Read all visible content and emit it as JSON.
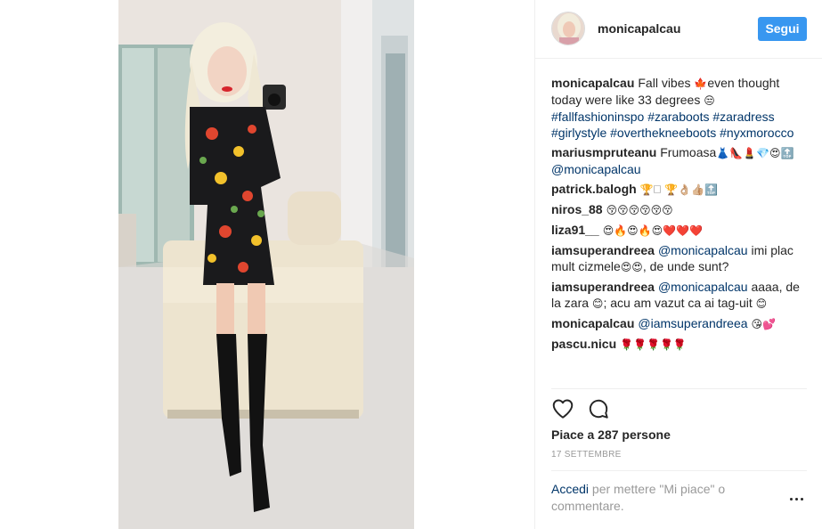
{
  "post": {
    "username": "monicapalcau",
    "follow_label": "Segui",
    "caption": {
      "user": "monicapalcau",
      "text1": "Fall vibes ",
      "text2": "even thought today were like 33 degrees ",
      "hashtags": [
        "#fallfashioninspo",
        "#zaraboots",
        "#zaradress",
        "#girlystyle",
        "#overthekneeboots",
        "#nyxmorocco"
      ]
    },
    "comments": [
      {
        "user": "mariusmpruteanu",
        "text": "Frumoasa",
        "emoji": "👗👠💄💎😍🔝",
        "mention": "@monicapalcau"
      },
      {
        "user": "patrick.balogh",
        "text": "",
        "emoji": "🏆🗆 🏆👌🏼👍🏼🔝"
      },
      {
        "user": "niros_88",
        "text": "",
        "emoji": "😚😚😚😚😚😚"
      },
      {
        "user": "liza91__",
        "text": "",
        "emoji": "😍🔥😍🔥😍❤️❤️❤️"
      },
      {
        "user": "iamsuperandreea",
        "mention": "@monicapalcau",
        "text": "imi plac mult cizmele",
        "emoji2": "😍😍",
        "text2": ", de unde sunt?"
      },
      {
        "user": "iamsuperandreea",
        "mention": "@monicapalcau",
        "text": "aaaa, de la zara ",
        "emoji2": "😊",
        "text2": "; acu am vazut ca ai tag-uit ",
        "emoji3": "😊"
      },
      {
        "user": "monicapalcau",
        "mention": "@iamsuperandreea",
        "emoji": "😘💕"
      },
      {
        "user": "pascu.nicu",
        "emoji": "🌹🌹🌹🌹🌹"
      }
    ],
    "caption_emoji1": "🍁",
    "caption_emoji2": "😒",
    "likes_text": "Piace a 287 persone",
    "date": "17 SETTEMBRE",
    "add_comment": {
      "link": "Accedi",
      "text": " per mettere \"Mi piace\" o commentare."
    }
  },
  "icons": {
    "like": "heart-icon",
    "comment": "comment-icon",
    "more": "more-options-icon"
  },
  "colors": {
    "follow_button": "#3897f0",
    "link": "#003569",
    "muted": "#999999"
  }
}
